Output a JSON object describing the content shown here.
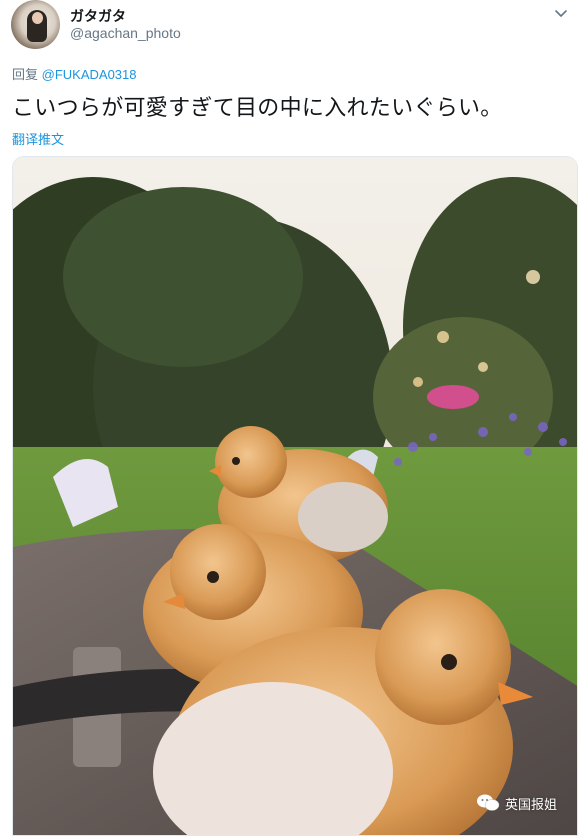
{
  "tweet": {
    "display_name": "ガタガタ",
    "handle": "@agachan_photo",
    "reply_prefix": "回复",
    "reply_to": "@FUKADA0318",
    "text": "こいつらが可愛すぎて目の中に入れたいぐらい。",
    "translate_label": "翻译推文"
  },
  "icons": {
    "avatar": "user-avatar",
    "menu": "chevron-down-icon",
    "watermark": "wechat-icon"
  },
  "watermark": {
    "label": "英国报姐"
  },
  "colors": {
    "link": "#1b95e0",
    "secondary_text": "#657786",
    "primary_text": "#14171a"
  }
}
